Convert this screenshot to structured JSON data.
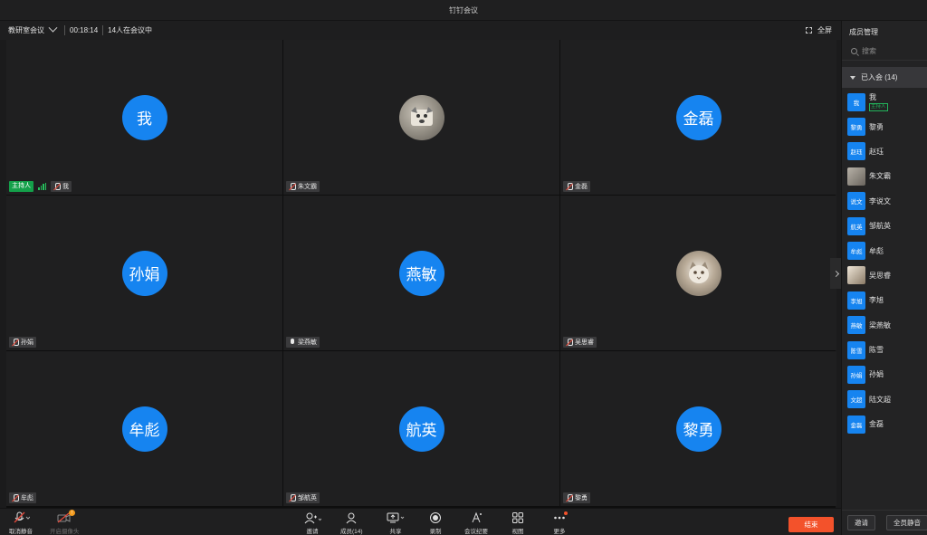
{
  "window": {
    "title": "钉钉会议"
  },
  "meeting_bar": {
    "meeting_name": "教研室会议",
    "elapsed": "00:18:14",
    "participants_text": "14人在会议中",
    "fullscreen_label": "全屏"
  },
  "tiles": [
    {
      "avatar_text": "我",
      "name": "我",
      "photo": false,
      "host_badge": "主持人",
      "mic": "off"
    },
    {
      "avatar_text": "",
      "name": "朱文霸",
      "photo": "dog",
      "mic": "off"
    },
    {
      "avatar_text": "金磊",
      "name": "金磊",
      "photo": false,
      "mic": "off"
    },
    {
      "avatar_text": "孙娟",
      "name": "孙娟",
      "photo": false,
      "mic": "off"
    },
    {
      "avatar_text": "燕敏",
      "name": "梁燕敏",
      "photo": false,
      "mic": "on"
    },
    {
      "avatar_text": "",
      "name": "吴思睿",
      "photo": "cat",
      "mic": "off"
    },
    {
      "avatar_text": "牟彪",
      "name": "牟彪",
      "photo": false,
      "mic": "off"
    },
    {
      "avatar_text": "航英",
      "name": "邹航英",
      "photo": false,
      "mic": "off"
    },
    {
      "avatar_text": "黎勇",
      "name": "黎勇",
      "photo": false,
      "mic": "off"
    }
  ],
  "sidebar": {
    "title": "成员管理",
    "search_placeholder": "搜索",
    "group_label": "已入会 (14)",
    "host_tag": "主持人",
    "members": [
      {
        "avatar": "我",
        "name": "我"
      },
      {
        "avatar": "黎勇",
        "name": "黎勇"
      },
      {
        "avatar": "赵珏",
        "name": "赵珏"
      },
      {
        "avatar": "",
        "name": "朱文霸",
        "photo": "dog"
      },
      {
        "avatar": "说文",
        "name": "李说文"
      },
      {
        "avatar": "航英",
        "name": "邹航英"
      },
      {
        "avatar": "牟彪",
        "name": "牟彪"
      },
      {
        "avatar": "",
        "name": "吴思睿",
        "photo": "cat"
      },
      {
        "avatar": "李旭",
        "name": "李旭"
      },
      {
        "avatar": "燕敏",
        "name": "梁燕敏"
      },
      {
        "avatar": "陈雪",
        "name": "陈雪"
      },
      {
        "avatar": "孙娟",
        "name": "孙娟"
      },
      {
        "avatar": "文超",
        "name": "陆文超"
      },
      {
        "avatar": "金磊",
        "name": "金磊"
      }
    ],
    "invite_label": "邀请",
    "mute_all_label": "全员静音"
  },
  "toolbar": {
    "unmute": "取消静音",
    "camera": "开启摄像头",
    "invite": "邀请",
    "members": "成员(14)",
    "share": "共享",
    "record": "录制",
    "minutes": "会议纪要",
    "view": "视图",
    "more": "更多",
    "end": "结束"
  },
  "colors": {
    "avatar_blue": "#1684f0",
    "host_green": "#14a04a",
    "end_red": "#f3522b"
  }
}
